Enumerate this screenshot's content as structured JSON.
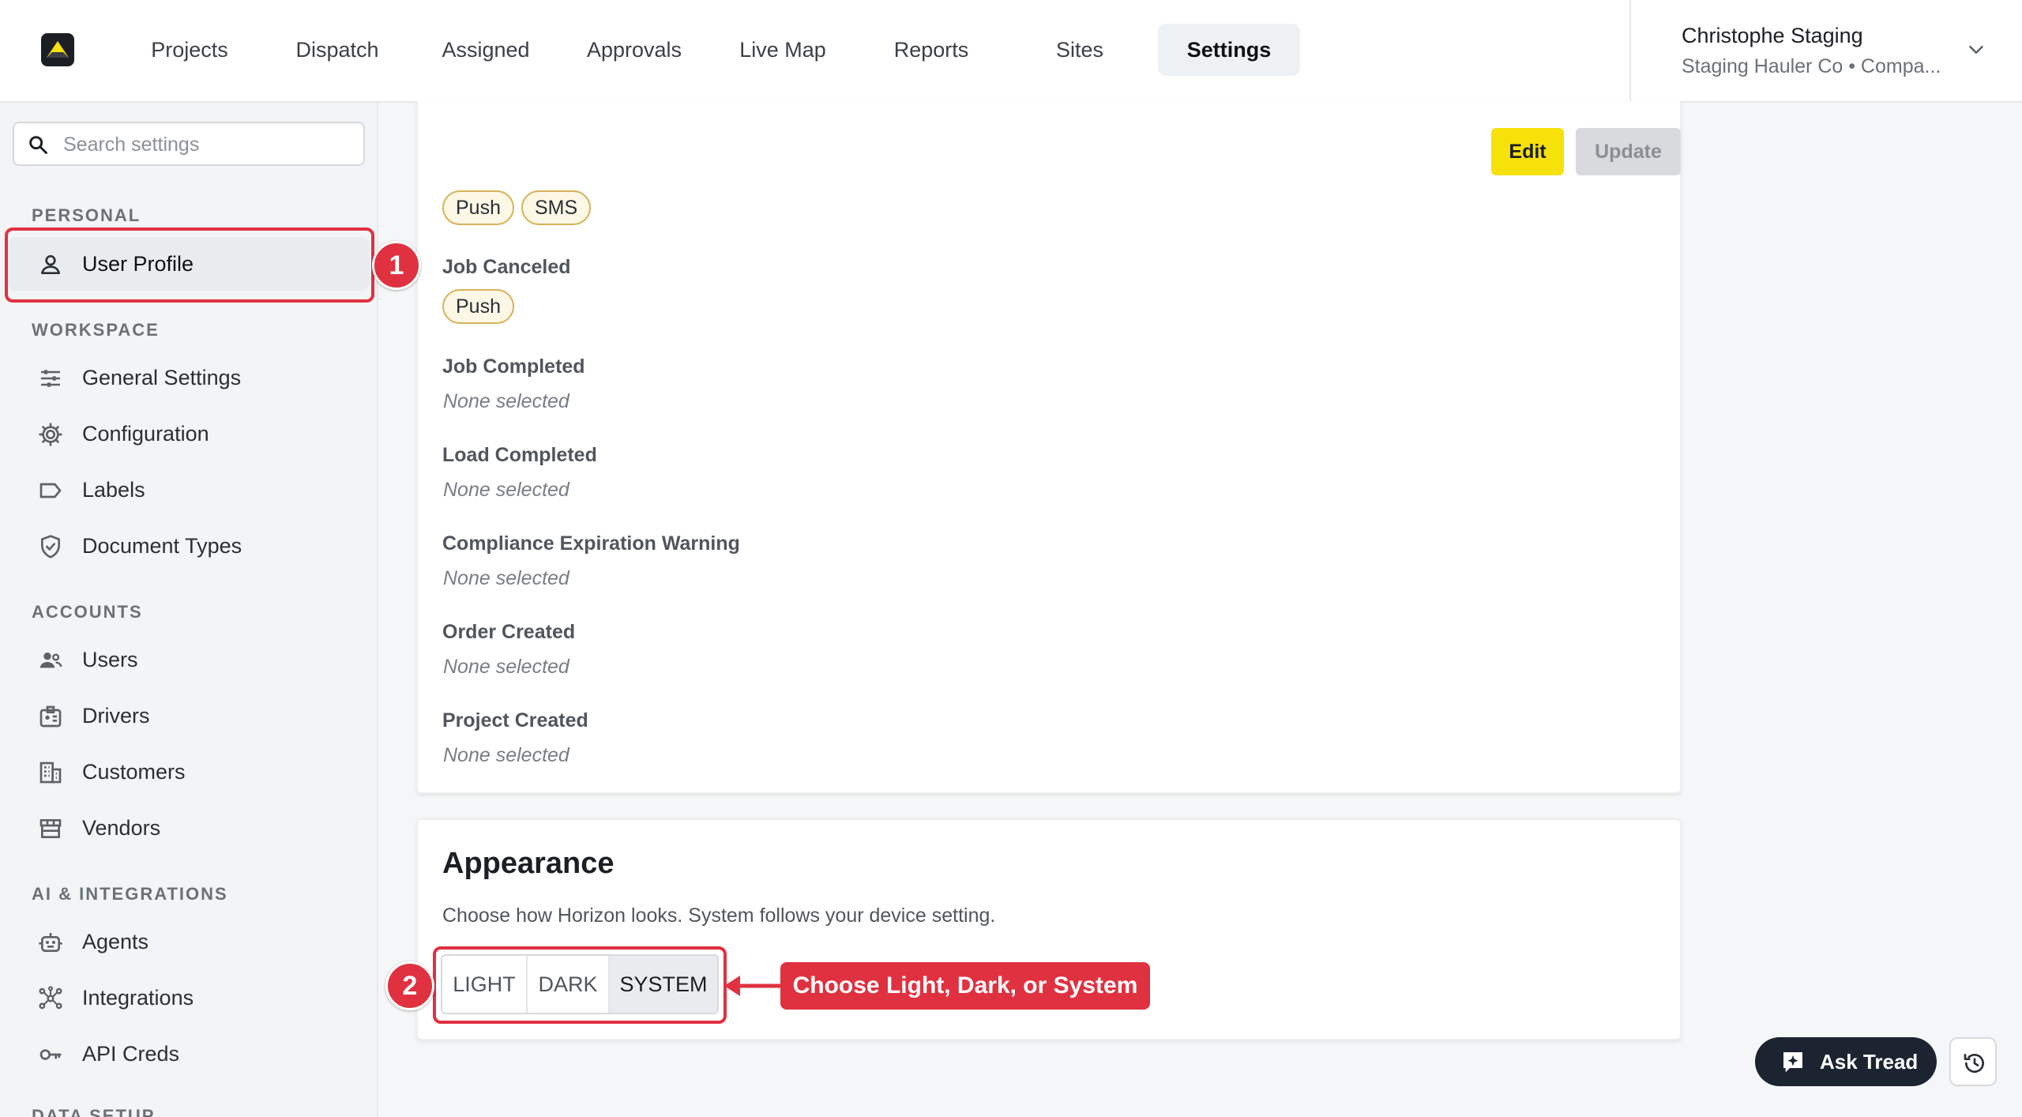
{
  "nav": {
    "tabs": [
      {
        "label": "Projects"
      },
      {
        "label": "Dispatch"
      },
      {
        "label": "Assigned"
      },
      {
        "label": "Approvals"
      },
      {
        "label": "Live Map"
      },
      {
        "label": "Reports"
      },
      {
        "label": "Sites"
      },
      {
        "label": "Settings",
        "active": true
      }
    ],
    "user": {
      "name": "Christophe Staging",
      "org": "Staging Hauler Co • Compa..."
    }
  },
  "sidebar": {
    "search_placeholder": "Search settings",
    "sections": [
      {
        "title": "PERSONAL",
        "items": [
          {
            "label": "User Profile",
            "icon": "user-icon",
            "active": true
          }
        ]
      },
      {
        "title": "WORKSPACE",
        "items": [
          {
            "label": "General Settings",
            "icon": "sliders-icon"
          },
          {
            "label": "Configuration",
            "icon": "gear-icon"
          },
          {
            "label": "Labels",
            "icon": "tag-icon"
          },
          {
            "label": "Document Types",
            "icon": "shield-icon"
          }
        ]
      },
      {
        "title": "ACCOUNTS",
        "items": [
          {
            "label": "Users",
            "icon": "users-icon"
          },
          {
            "label": "Drivers",
            "icon": "id-badge-icon"
          },
          {
            "label": "Customers",
            "icon": "building-icon"
          },
          {
            "label": "Vendors",
            "icon": "store-icon"
          }
        ]
      },
      {
        "title": "AI & INTEGRATIONS",
        "items": [
          {
            "label": "Agents",
            "icon": "robot-icon"
          },
          {
            "label": "Integrations",
            "icon": "network-icon"
          },
          {
            "label": "API Creds",
            "icon": "key-icon"
          }
        ]
      },
      {
        "title": "DATA SETUP",
        "items": []
      }
    ]
  },
  "notifications": {
    "edit_label": "Edit",
    "update_label": "Update",
    "top_chips": [
      "Push",
      "SMS"
    ],
    "events": [
      {
        "label": "Job Canceled",
        "chips": [
          "Push"
        ]
      },
      {
        "label": "Job Completed",
        "value": "None selected"
      },
      {
        "label": "Load Completed",
        "value": "None selected"
      },
      {
        "label": "Compliance Expiration Warning",
        "value": "None selected"
      },
      {
        "label": "Order Created",
        "value": "None selected"
      },
      {
        "label": "Project Created",
        "value": "None selected"
      }
    ]
  },
  "appearance": {
    "title": "Appearance",
    "description": "Choose how Horizon looks. System follows your device setting.",
    "options": [
      "LIGHT",
      "DARK",
      "SYSTEM"
    ],
    "selected": "SYSTEM"
  },
  "annotations": {
    "step1": "1",
    "step2": "2",
    "callout": "Choose Light, Dark, or System"
  },
  "floating": {
    "ask_label": "Ask Tread"
  },
  "colors": {
    "accent_yellow": "#f7e10b",
    "annotation_red": "#e03140",
    "chip_border": "#d8b25a"
  }
}
